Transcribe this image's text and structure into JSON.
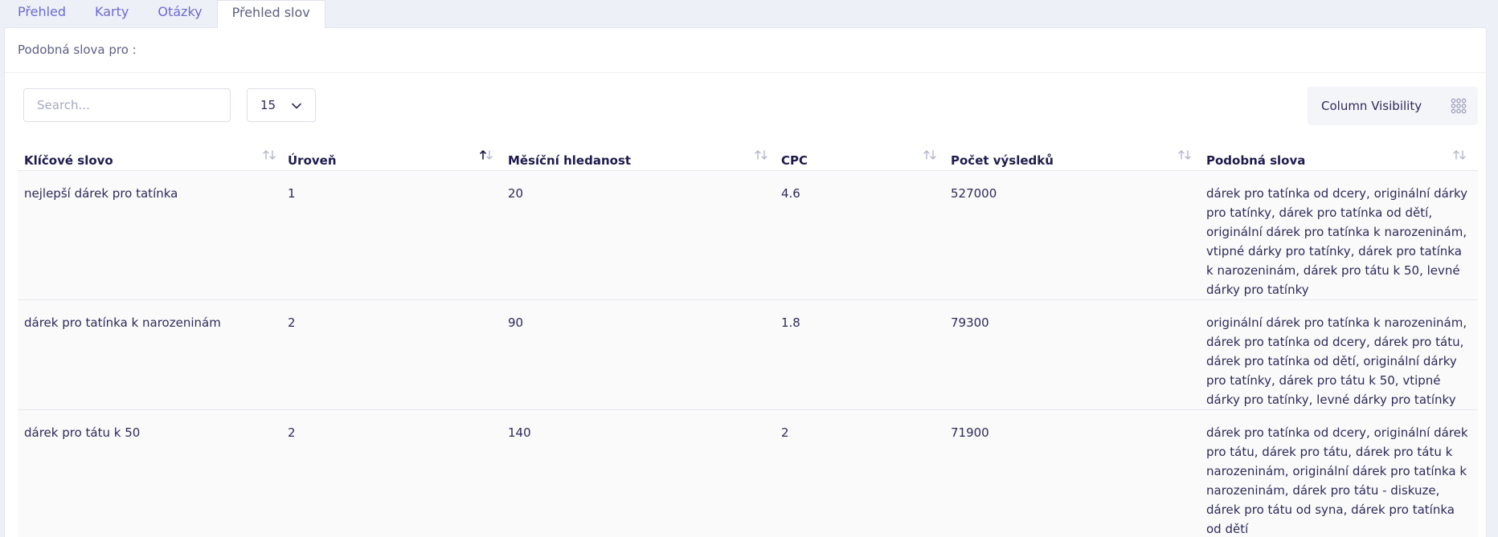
{
  "tabs": [
    {
      "label": "Přehled"
    },
    {
      "label": "Karty"
    },
    {
      "label": "Otázky"
    },
    {
      "label": "Přehled slov"
    }
  ],
  "header": {
    "title": "Podobná slova pro :"
  },
  "toolbar": {
    "search_placeholder": "Search...",
    "page_size": "15",
    "column_visibility_label": "Column Visibility"
  },
  "table": {
    "columns": [
      {
        "label": "Klíčové slovo",
        "sort": "none"
      },
      {
        "label": "Úroveň",
        "sort": "ascending"
      },
      {
        "label": "Měsíční hledanost",
        "sort": "none"
      },
      {
        "label": "CPC",
        "sort": "none"
      },
      {
        "label": "Počet výsledků",
        "sort": "none"
      },
      {
        "label": "Podobná slova",
        "sort": "none"
      }
    ],
    "rows": [
      {
        "keyword": "nejlepší dárek pro tatínka",
        "level": "1",
        "monthly": "20",
        "cpc": "4.6",
        "results": "527000",
        "similar": "dárek pro tatínka od dcery, originální dárky pro tatínky, dárek pro tatínka od dětí, originální dárek pro tatínka k narozeninám, vtipné dárky pro tatínky, dárek pro tatínka k narozeninám, dárek pro tátu k 50, levné dárky pro tatínky"
      },
      {
        "keyword": "dárek pro tatínka k narozeninám",
        "level": "2",
        "monthly": "90",
        "cpc": "1.8",
        "results": "79300",
        "similar": "originální dárek pro tatínka k narozeninám, dárek pro tatínka od dcery, dárek pro tátu, dárek pro tatínka od dětí, originální dárky pro tatínky, dárek pro tátu k 50, vtipné dárky pro tatínky, levné dárky pro tatínky"
      },
      {
        "keyword": "dárek pro tátu k 50",
        "level": "2",
        "monthly": "140",
        "cpc": "2",
        "results": "71900",
        "similar": "dárek pro tatínka od dcery, originální dárek pro tátu, dárek pro tátu, dárek pro tátu k narozeninám, originální dárek pro tatínka k narozeninám, dárek pro tátu - diskuze, dárek pro tátu od syna, dárek pro tatínka od dětí"
      }
    ]
  },
  "colors": {
    "tab_link": "#6c6ad0",
    "header_text": "#1f1c4d",
    "row_background": "#fafafa",
    "page_background": "#eef0f8"
  }
}
